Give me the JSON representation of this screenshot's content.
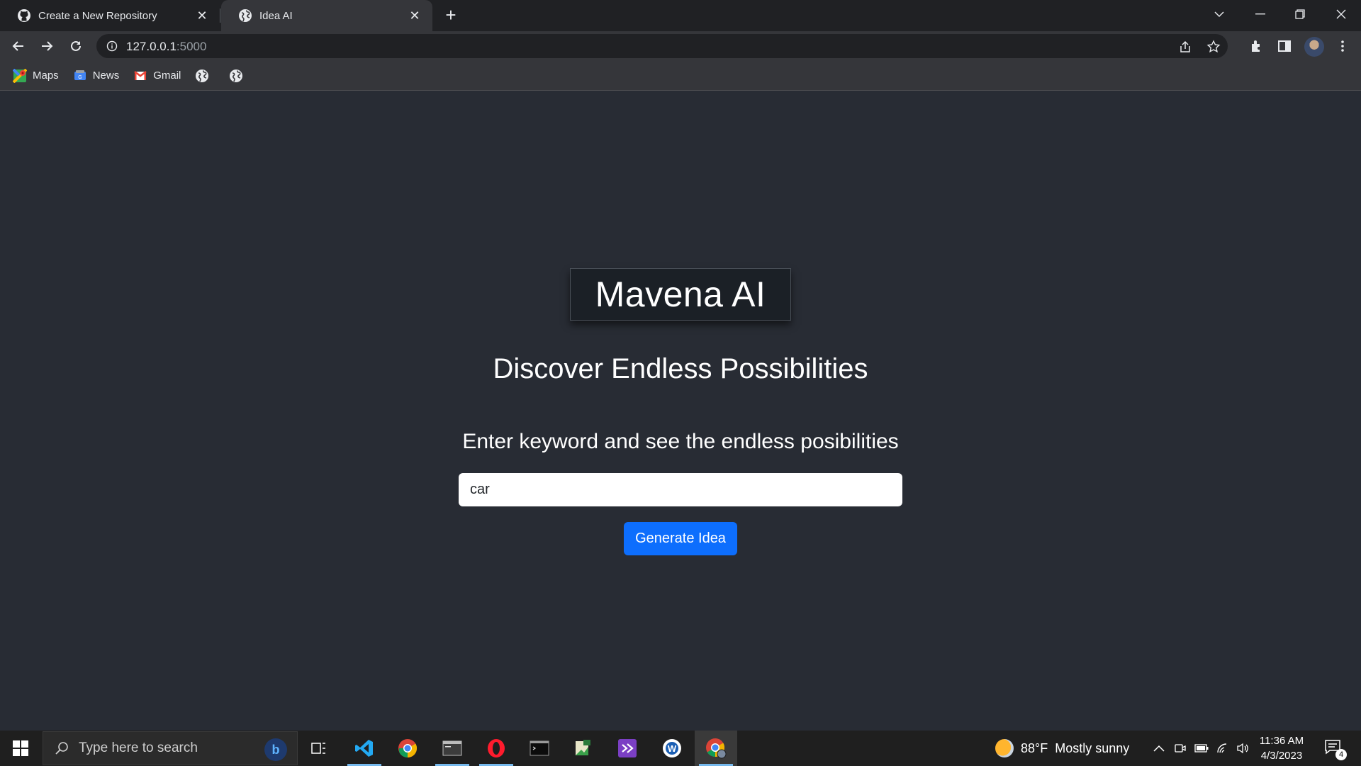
{
  "browser": {
    "tabs": [
      {
        "title": "Create a New Repository",
        "icon": "github-icon",
        "active": false
      },
      {
        "title": "Idea AI",
        "icon": "globe-icon",
        "active": true
      }
    ],
    "address_host": "127.0.0.1",
    "address_port": ":5000",
    "bookmarks": [
      {
        "label": "Maps",
        "icon": "maps-icon"
      },
      {
        "label": "News",
        "icon": "news-icon"
      },
      {
        "label": "Gmail",
        "icon": "gmail-icon"
      },
      {
        "label": "",
        "icon": "globe-icon"
      },
      {
        "label": "",
        "icon": "globe-icon"
      }
    ]
  },
  "page": {
    "logo_text": "Mavena AI",
    "subtitle": "Discover Endless Possibilities",
    "prompt": "Enter keyword and see the endless posibilities",
    "keyword_value": "car",
    "generate_button": "Generate Idea"
  },
  "taskbar": {
    "search_placeholder": "Type here to search",
    "weather_temp": "88°F",
    "weather_desc": "Mostly sunny",
    "time": "11:36 AM",
    "date": "4/3/2023",
    "notification_count": "4",
    "colors": {
      "accent": "#0d6efd",
      "active_indicator": "#76b9ed"
    }
  }
}
